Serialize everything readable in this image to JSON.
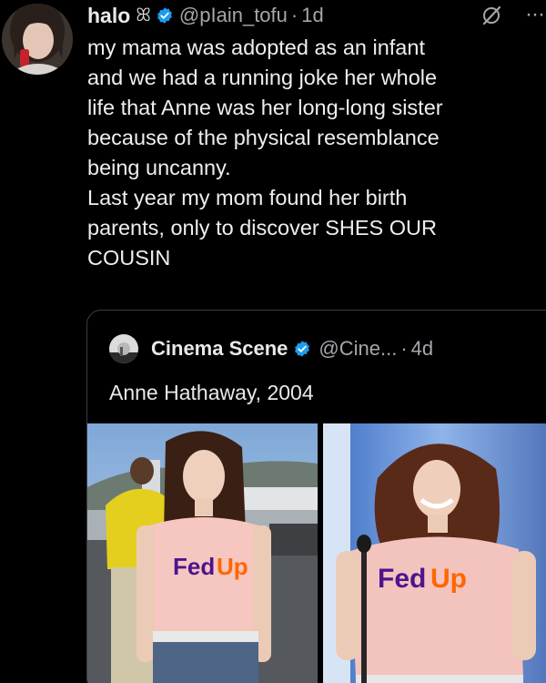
{
  "tweet": {
    "author_name": "halo",
    "name_glyph": "ꕤ",
    "handle": "@pIain_tofu",
    "separator": "·",
    "time": "1d",
    "more": "···",
    "lines": [
      "my mama was adopted as an infant",
      "and we had a running joke her whole",
      "life that Anne was her long-long sister",
      "because of the physical resemblance",
      "being uncanny.",
      "Last year my mom found her birth",
      "parents, only to discover SHES OUR",
      "COUSIN"
    ]
  },
  "quote": {
    "author_name": "Cinema Scene",
    "handle": "@Cine...",
    "separator": "·",
    "time": "4d",
    "text": "Anne Hathaway, 2004",
    "photos": [
      {
        "shirt_text": "FedUp",
        "icon": "photo-left"
      },
      {
        "shirt_text": "FedUp",
        "icon": "photo-right"
      }
    ]
  },
  "colors": {
    "background": "#000000",
    "text": "#e7e9ea",
    "muted": "#a3a7ac",
    "verified": "#1d9bf0",
    "border": "#3a3d40",
    "fed_purple": "#4d148c",
    "fed_orange": "#ff6600"
  },
  "icons": [
    "verified-badge-icon",
    "grok-icon",
    "more-icon"
  ]
}
